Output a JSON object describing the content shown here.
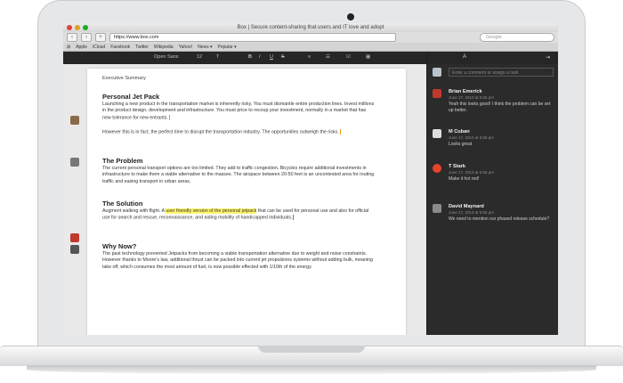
{
  "browser": {
    "title": "Box | Secure content-sharing that users and IT love and adopt",
    "address": "https://www.box.com",
    "search_placeholder": "Google",
    "bookmarks": [
      "Apple",
      "iCloud",
      "Facebook",
      "Twitter",
      "Wikipedia",
      "Yahoo!",
      "News ▾",
      "Popular ▾"
    ]
  },
  "editor": {
    "font_name": "Open Sans",
    "font_size": "12"
  },
  "document": {
    "label": "Executive Summary",
    "sections": [
      {
        "heading": "Personal Jet Pack",
        "paragraphs": [
          "Launching a new product in the transportation market is inherently risky. You must dismantle entire production lines. Invest millions in the product design, development and infrastructure. You must price to recoup your investment, normally in a market that has new tolerance for new entrants.",
          "However this is in fact, the perfect time to disrupt the transportation industry. The opportunities outweigh the risks."
        ]
      },
      {
        "heading": "The Problem",
        "paragraphs": [
          "The current personal transport options are too limited. They add to traffic congestion. Bicycles require additional investments in infrastructure to make them a viable alternative to the masses. The airspace between 20-50 feet is an uncontested area for routing traffic and easing transport in urban areas."
        ]
      },
      {
        "heading": "The Solution",
        "para_start": "Augment walking with flight. A ",
        "para_highlight": "user friendly version of the personal jetpack",
        "para_end": " that can be used for personal use and also for official use for search and rescue, reconnaissance, and aiding mobility of handicapped individuals."
      },
      {
        "heading": "Why Now?",
        "paragraphs": [
          "The past technology prevented Jetpacks from becoming a viable transportation alternative due to weight and noise constraints. However thanks to Moore's law, additional thrust can be packed into current jet propulsions systems without adding bulk, meaning take off, which consumes the most amount of fuel, is now possible effected with 1/10th of the energy."
        ]
      }
    ]
  },
  "comments": {
    "input_placeholder": "Enter a comment or assign a task",
    "items": [
      {
        "name": "Brian Emerick",
        "time": "June 17, 2013 at 5:55 pm",
        "text": "Yeah this looks good! I think the problem can be set up better.",
        "color": "#c0392b"
      },
      {
        "name": "M Cuban",
        "time": "June 17, 2013 at 5:55 pm",
        "text": "Looks great",
        "color": "#333333"
      },
      {
        "name": "T Stark",
        "time": "June 17, 2013 at 5:55 pm",
        "text": "Make it hot red!",
        "color": "#e8432b"
      },
      {
        "name": "David Maynard",
        "time": "June 17, 2013 at 5:55 pm",
        "text": "We need to mention our phased release schedule?",
        "color": "#8a8a8a"
      }
    ]
  },
  "colors": {
    "highlight": "#fff56b",
    "panel_bg": "#2b2b2b",
    "cursor_orange": "#f39c12",
    "cursor_green": "#7cc644"
  }
}
